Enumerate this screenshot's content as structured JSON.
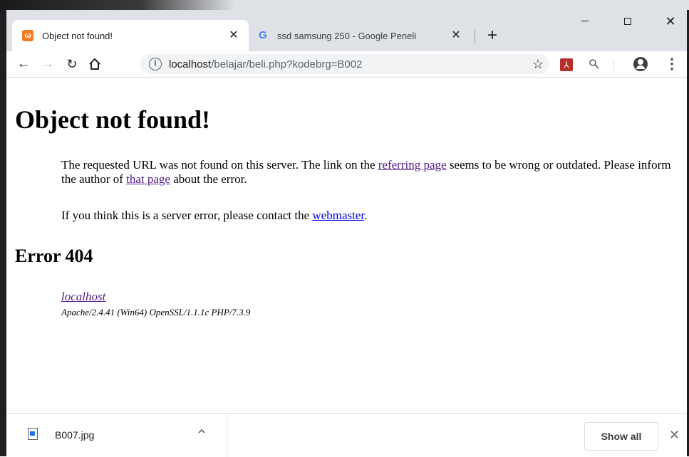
{
  "browser": {
    "tabs": [
      {
        "title": "Object not found!",
        "favicon": "xampp-icon",
        "active": true
      },
      {
        "title": "ssd samsung 250 - Google Peneli",
        "favicon": "google-g-icon",
        "active": false
      }
    ],
    "close_glyph": "✕",
    "new_tab_glyph": "+",
    "window_close_glyph": "✕",
    "url": {
      "host": "localhost",
      "path": "/belajar/beli.php?kodebrg=B002"
    },
    "info_glyph": "i",
    "icons": [
      "back-icon",
      "forward-icon",
      "reload-icon",
      "home-icon",
      "info-icon",
      "star-icon",
      "pdf-extension-icon",
      "search-extension-icon",
      "profile-icon",
      "menu-icon"
    ]
  },
  "page": {
    "title": "Object not found!",
    "para1": {
      "t1": "The requested URL was not found on this server. The link on the ",
      "link1": "referring page",
      "t2": " seems to be wrong or outdated. Please inform the author of ",
      "link2": "that page",
      "t3": " about the error."
    },
    "para2": {
      "t1": "If you think this is a server error, please contact the ",
      "link": "webmaster",
      "t2": "."
    },
    "error_heading": "Error 404",
    "address_link": "localhost",
    "server_signature": "Apache/2.4.41 (Win64) OpenSSL/1.1.1c PHP/7.3.9"
  },
  "downloads": {
    "file_name": "B007.jpg",
    "show_all_label": "Show all",
    "close_glyph": "✕"
  },
  "colors": {
    "visited_link": "#551a8b",
    "link": "#0000ee",
    "tab_strip": "#dee1e6",
    "xampp_orange": "#f37b22"
  }
}
